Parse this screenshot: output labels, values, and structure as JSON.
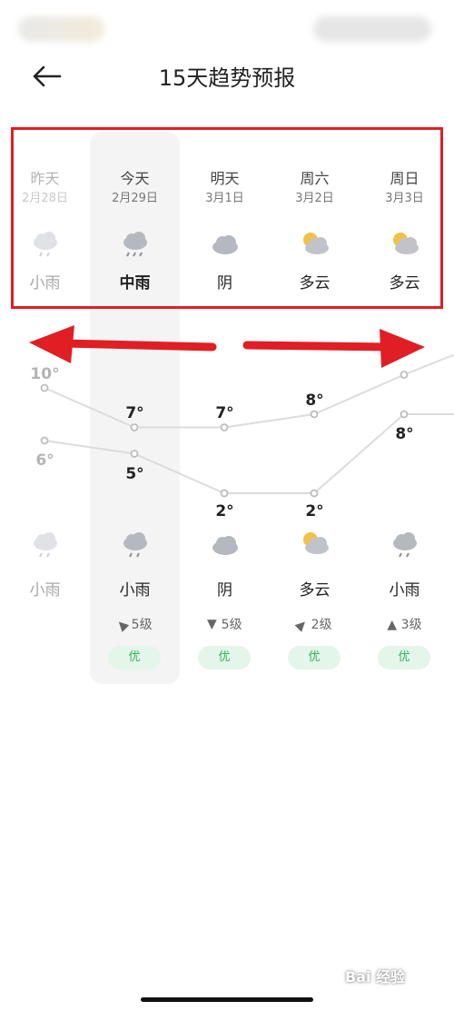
{
  "header": {
    "back_icon": "left-arrow-icon",
    "title": "15天趋势预报"
  },
  "days": [
    {
      "name": "昨天",
      "date": "2月28日",
      "cond_top": "小雨",
      "icon_top": "light-rain-icon",
      "high": "10°",
      "low": "6°",
      "icon_bottom": "light-rain-icon",
      "cond_bottom": "小雨",
      "wind": "",
      "aqi": ""
    },
    {
      "name": "今天",
      "date": "2月29日",
      "cond_top": "中雨",
      "icon_top": "moderate-rain-icon",
      "high": "7°",
      "low": "5°",
      "icon_bottom": "light-rain-icon",
      "cond_bottom": "小雨",
      "wind": "5级",
      "wind_icon": "wind-direction-icon",
      "aqi": "优"
    },
    {
      "name": "明天",
      "date": "3月1日",
      "cond_top": "阴",
      "icon_top": "overcast-icon",
      "high": "7°",
      "low": "2°",
      "icon_bottom": "overcast-icon",
      "cond_bottom": "阴",
      "wind": "5级",
      "wind_icon": "wind-direction-icon",
      "aqi": "优"
    },
    {
      "name": "周六",
      "date": "3月2日",
      "cond_top": "多云",
      "icon_top": "partly-cloudy-icon",
      "high": "8°",
      "low": "2°",
      "icon_bottom": "partly-cloudy-icon",
      "cond_bottom": "多云",
      "wind": "2级",
      "wind_icon": "wind-direction-icon",
      "aqi": "优"
    },
    {
      "name": "周日",
      "date": "3月3日",
      "cond_top": "多云",
      "icon_top": "partly-cloudy-icon",
      "high": "",
      "low": "8°",
      "icon_bottom": "light-rain-icon",
      "cond_bottom": "小雨",
      "wind": "3级",
      "wind_icon": "wind-direction-icon",
      "aqi": "优"
    }
  ],
  "chart_data": {
    "type": "line",
    "categories": [
      "昨天",
      "今天",
      "明天",
      "周六",
      "周日"
    ],
    "series": [
      {
        "values": [
          10,
          7,
          7,
          8,
          11
        ]
      },
      {
        "values": [
          6,
          5,
          2,
          2,
          8
        ]
      }
    ]
  },
  "annotation": {
    "color": "#e01e24"
  },
  "watermark": {
    "text": "Bai 经验"
  },
  "colors": {
    "aqi_good": "#2fb55a",
    "aqi_bg": "#e4f5ea",
    "today_bg": "#f4f4f4"
  }
}
